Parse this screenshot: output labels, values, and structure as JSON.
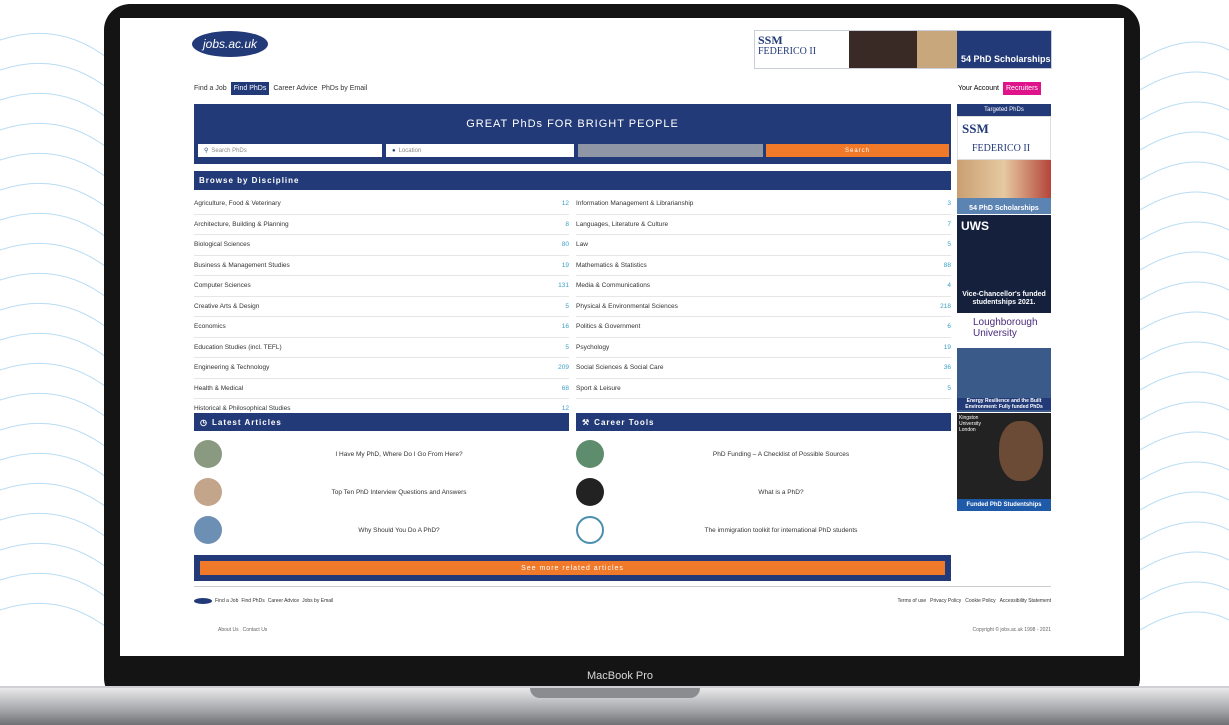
{
  "device": {
    "label": "MacBook Pro"
  },
  "site": {
    "logo": "jobs.ac.uk",
    "top_ad": {
      "brand": "SSM",
      "sub": "FEDERICO II",
      "text": "54 PhD Scholarships"
    },
    "nav": [
      "Find a Job",
      "Find PhDs",
      "Career Advice",
      "PhDs by Email"
    ],
    "nav_active": "Find PhDs",
    "account": {
      "your_account": "Your Account",
      "recruiters": "Recruiters"
    },
    "hero": {
      "title": "GREAT PhDs FOR BRIGHT PEOPLE",
      "search_placeholder": "Search PhDs",
      "location_placeholder": "Location",
      "search_button": "Search"
    },
    "browse_title": "Browse by Discipline",
    "disciplines_left": [
      {
        "name": "Agriculture, Food & Veterinary",
        "count": "12"
      },
      {
        "name": "Architecture, Building & Planning",
        "count": "8"
      },
      {
        "name": "Biological Sciences",
        "count": "80"
      },
      {
        "name": "Business & Management Studies",
        "count": "19"
      },
      {
        "name": "Computer Sciences",
        "count": "131"
      },
      {
        "name": "Creative Arts & Design",
        "count": "5"
      },
      {
        "name": "Economics",
        "count": "16"
      },
      {
        "name": "Education Studies (incl. TEFL)",
        "count": "5"
      },
      {
        "name": "Engineering & Technology",
        "count": "209"
      },
      {
        "name": "Health & Medical",
        "count": "68"
      },
      {
        "name": "Historical & Philosophical Studies",
        "count": "12"
      }
    ],
    "disciplines_right": [
      {
        "name": "Information Management & Librarianship",
        "count": "3"
      },
      {
        "name": "Languages, Literature & Culture",
        "count": "7"
      },
      {
        "name": "Law",
        "count": "5"
      },
      {
        "name": "Mathematics & Statistics",
        "count": "88"
      },
      {
        "name": "Media & Communications",
        "count": "4"
      },
      {
        "name": "Physical & Environmental Sciences",
        "count": "218"
      },
      {
        "name": "Politics & Government",
        "count": "6"
      },
      {
        "name": "Psychology",
        "count": "19"
      },
      {
        "name": "Social Sciences & Social Care",
        "count": "36"
      },
      {
        "name": "Sport & Leisure",
        "count": "5"
      }
    ],
    "latest_articles_title": "Latest Articles",
    "career_tools_title": "Career Tools",
    "articles_left": [
      "I Have My PhD, Where Do I Go From Here?",
      "Top Ten PhD Interview Questions and Answers",
      "Why Should You Do A PhD?"
    ],
    "articles_right": [
      "PhD Funding – A Checklist of Possible Sources",
      "What is a PhD?",
      "The immigration toolkit for international PhD students"
    ],
    "see_more": "See more related articles",
    "footer_links": [
      "Find a Job",
      "Find PhDs",
      "Career Advice",
      "Jobs by Email"
    ],
    "footer_right": [
      "Terms of use",
      "Privacy Policy",
      "Cookie Policy",
      "Accessibility Statement"
    ],
    "footer_bottom": [
      "About Us",
      "Contact Us"
    ],
    "copyright": "Copyright © jobs.ac.uk 1998 - 2021",
    "sidebar": {
      "header": "Targeted PhDs",
      "ads": [
        {
          "name": "ssm",
          "title": "SSM",
          "sub": "FEDERICO II"
        },
        {
          "name": "scholarships",
          "caption": "54 PhD Scholarships"
        },
        {
          "name": "uws",
          "title": "UWS",
          "caption": "Vice-Chancellor's funded studentships 2021."
        },
        {
          "name": "loughborough",
          "title": "Loughborough University",
          "caption": "Energy Resilience and the Built Environment: Fully funded PhDs"
        },
        {
          "name": "kingston",
          "title": "Kingston University London",
          "caption": "Funded PhD Studentships"
        }
      ]
    }
  }
}
